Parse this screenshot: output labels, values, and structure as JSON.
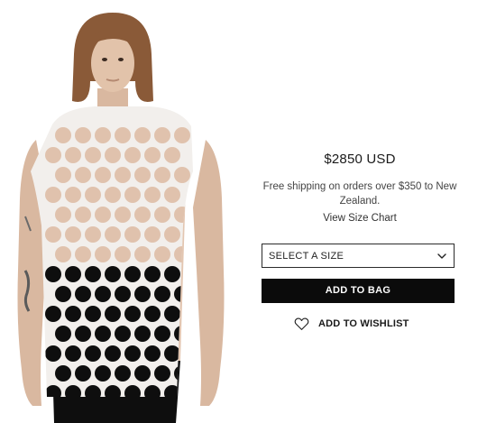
{
  "product": {
    "image_alt": "Model wearing white lattice cut-out sleeveless top"
  },
  "details": {
    "price": "$2850 USD",
    "shipping_text": "Free shipping on orders over $350 to New Zealand.",
    "size_chart_link": "View Size Chart",
    "size_select": {
      "selected": "SELECT A SIZE",
      "icon": "chevron-down-icon"
    },
    "add_to_bag_label": "ADD TO BAG",
    "wishlist": {
      "label": "ADD TO WISHLIST",
      "icon": "heart-outline-icon"
    }
  },
  "colors": {
    "button_bg": "#0b0b0b",
    "button_text": "#ffffff",
    "border": "#2b2b2b"
  }
}
